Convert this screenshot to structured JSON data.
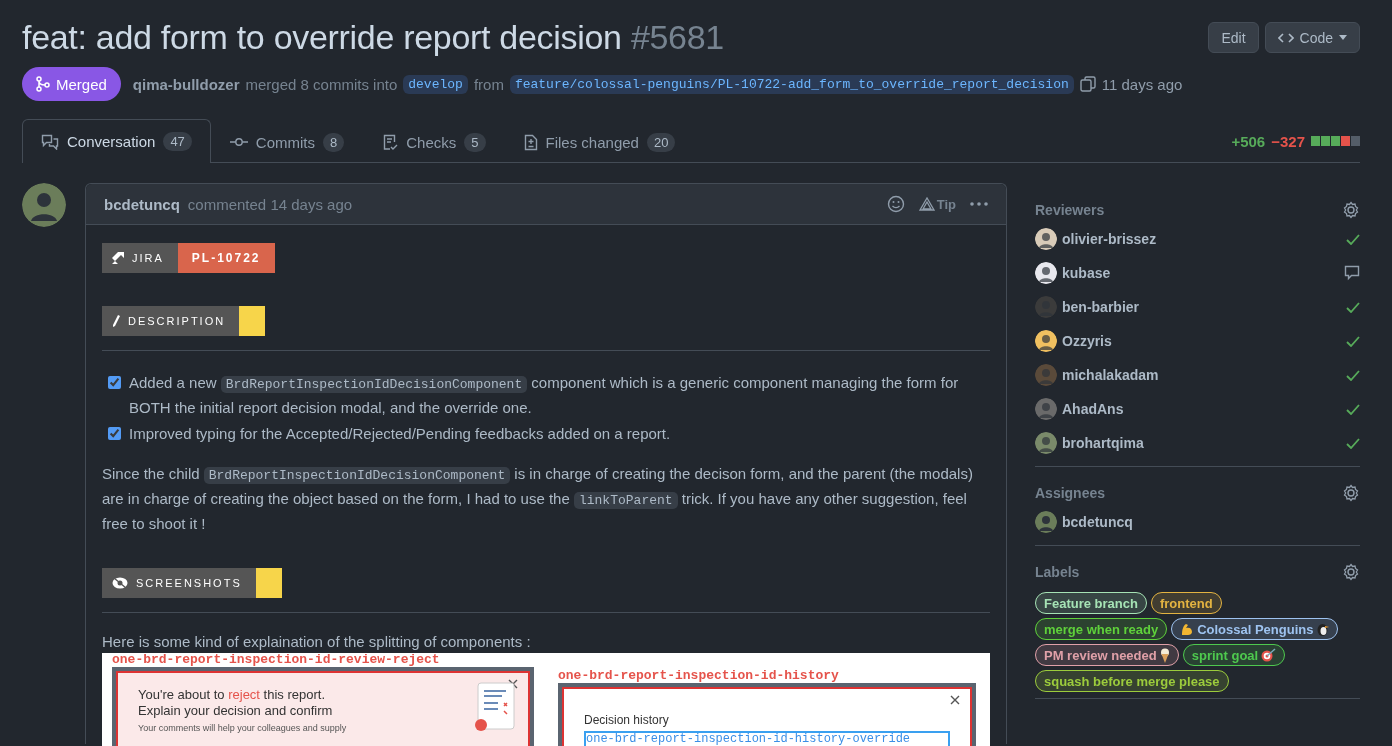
{
  "title": {
    "text": "feat: add form to override report decision",
    "number": "#5681"
  },
  "header_buttons": [
    {
      "label": "Edit",
      "kind": "plain"
    },
    {
      "label": "Code",
      "kind": "code"
    }
  ],
  "state": "Merged",
  "merge_info": {
    "author": "qima-bulldozer",
    "text": "merged 8 commits into",
    "base": "develop",
    "from": "from",
    "head": "feature/colossal-penguins/PL-10722-add_form_to_override_report_decision",
    "time": "11 days ago"
  },
  "tabs": [
    {
      "label": "Conversation",
      "count": "47",
      "selected": true
    },
    {
      "label": "Commits",
      "count": "8",
      "selected": false
    },
    {
      "label": "Checks",
      "count": "5",
      "selected": false
    },
    {
      "label": "Files changed",
      "count": "20",
      "selected": false
    }
  ],
  "diffstat": {
    "added": "+506",
    "removed": "−327",
    "blocks": [
      {
        "color": "#57ab5a"
      },
      {
        "color": "#57ab5a"
      },
      {
        "color": "#57ab5a"
      },
      {
        "color": "#e5534b"
      },
      {
        "color": "#545d68"
      }
    ]
  },
  "comment": {
    "author": "bcdetuncq",
    "action": "commented 14 days ago",
    "tip": "Tip",
    "jira": {
      "label": "JIRA",
      "key": "PL-10722"
    },
    "sections": [
      {
        "label": "DESCRIPTION"
      },
      {
        "label": "SCREENSHOTS"
      }
    ],
    "tasks": [
      {
        "checked": true,
        "parts": [
          {
            "kind": "text",
            "text": "Added a new "
          },
          {
            "kind": "code",
            "text": "BrdReportInspectionIdDecisionComponent"
          },
          {
            "kind": "text",
            "text": " component which is a generic component managing the form for BOTH the initial report decision modal, and the override one."
          }
        ]
      },
      {
        "checked": true,
        "parts": [
          {
            "kind": "text",
            "text": "Improved typing for the Accepted/Rejected/Pending feedbacks added on a report."
          }
        ]
      }
    ],
    "paragraph": [
      {
        "kind": "text",
        "text": "Since the child "
      },
      {
        "kind": "code",
        "text": "BrdReportInspectionIdDecisionComponent"
      },
      {
        "kind": "text",
        "text": " is in charge of creating the decison form, and the parent (the modals) are in charge of creating the object based on the form, I had to use the "
      },
      {
        "kind": "code",
        "text": "linkToParent"
      },
      {
        "kind": "text",
        "text": " trick. If you have any other suggestion, feel free to shoot it !"
      }
    ],
    "explanation": "Here is some kind of explaination of the splitting of components :",
    "screenshot": {
      "left_tag": "one-brd-report-inspection-id-review-reject",
      "left_title_before": "You're about to ",
      "left_title_highlight": "reject",
      "left_title_after": " this report.",
      "left_subtitle": "Explain your decision and confirm",
      "left_note": "Your comments will help your colleagues and supply",
      "right_tag": "one-brd-report-inspection-id-history",
      "right_title": "Decision history",
      "right_inner_tag": "one-brd-report-inspection-id-history-override"
    }
  },
  "reviewers": {
    "title": "Reviewers",
    "items": [
      {
        "name": "olivier-brissez",
        "kind": "approved"
      },
      {
        "name": "kubase",
        "kind": "commented"
      },
      {
        "name": "ben-barbier",
        "kind": "approved"
      },
      {
        "name": "Ozzyris",
        "kind": "approved"
      },
      {
        "name": "michalakadam",
        "kind": "approved"
      },
      {
        "name": "AhadAns",
        "kind": "approved"
      },
      {
        "name": "brohartqima",
        "kind": "approved"
      }
    ]
  },
  "assignees": {
    "title": "Assignees",
    "items": [
      "bcdetuncq"
    ]
  },
  "labels": {
    "title": "Labels",
    "items": [
      {
        "name": "Feature branch",
        "color": "#a6e3b5"
      },
      {
        "name": "frontend",
        "color": "#e3b341"
      },
      {
        "name": "merge when ready",
        "color": "#5fd13b"
      },
      {
        "name": "Colossal Penguins",
        "color": "#9ec3f0"
      },
      {
        "name": "PM review needed",
        "color": "#e0a0a8"
      },
      {
        "name": "sprint goal",
        "color": "#4ec94e"
      },
      {
        "name": "squash before merge please",
        "color": "#9ccc3c"
      }
    ]
  }
}
